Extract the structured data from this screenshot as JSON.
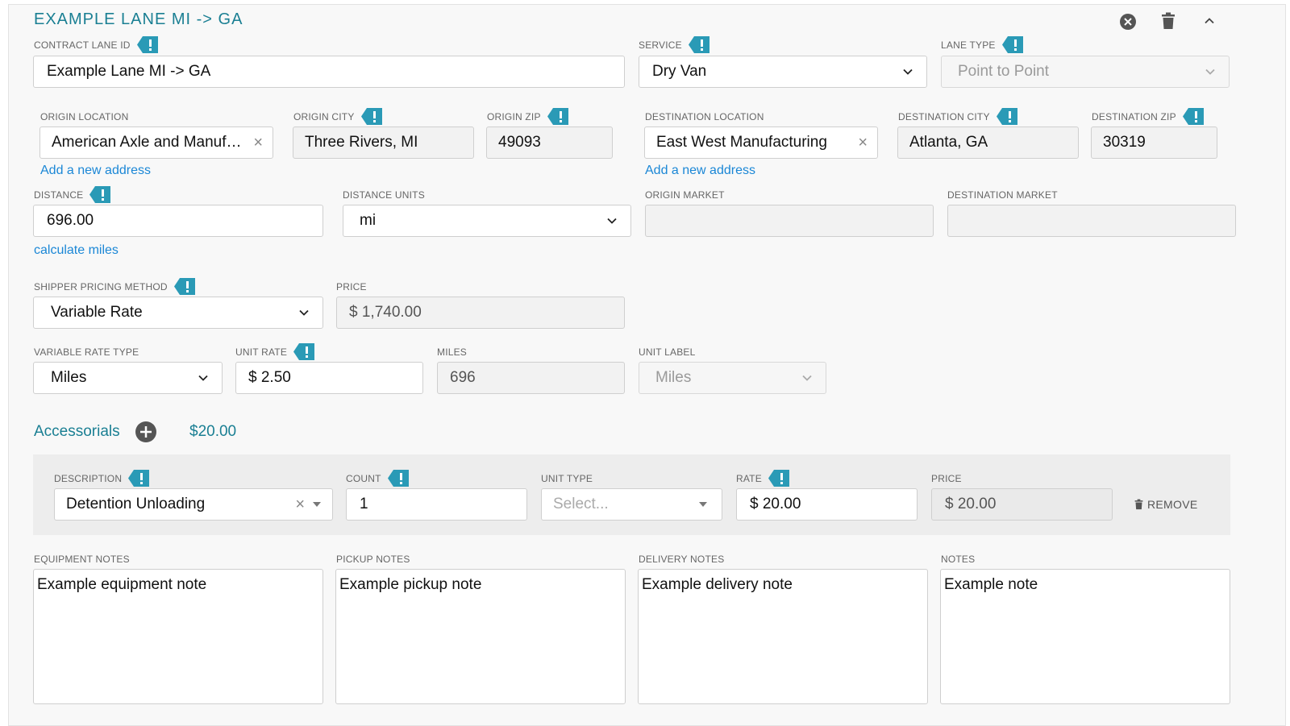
{
  "header": {
    "title": "EXAMPLE LANE MI -> GA"
  },
  "lane": {
    "contract_lane_id": {
      "label": "CONTRACT LANE ID",
      "value": "Example Lane MI -> GA"
    },
    "service": {
      "label": "SERVICE",
      "value": "Dry Van"
    },
    "lane_type": {
      "label": "LANE TYPE",
      "value": "Point to Point"
    }
  },
  "origin": {
    "location_label": "ORIGIN LOCATION",
    "location_value": "American Axle and Manufacturing",
    "city_label": "ORIGIN CITY",
    "city_value": "Three Rivers, MI",
    "zip_label": "ORIGIN ZIP",
    "zip_value": "49093",
    "add_address": "Add a new address"
  },
  "destination": {
    "location_label": "DESTINATION LOCATION",
    "location_value": "East West Manufacturing",
    "city_label": "DESTINATION CITY",
    "city_value": "Atlanta, GA",
    "zip_label": "DESTINATION ZIP",
    "zip_value": "30319",
    "add_address": "Add a new address"
  },
  "distance": {
    "label": "DISTANCE",
    "value": "696.00",
    "units_label": "DISTANCE UNITS",
    "units_value": "mi",
    "calculate_link": "calculate miles",
    "origin_market_label": "ORIGIN MARKET",
    "origin_market_value": "",
    "destination_market_label": "DESTINATION MARKET",
    "destination_market_value": ""
  },
  "pricing": {
    "method_label": "SHIPPER PRICING METHOD",
    "method_value": "Variable Rate",
    "price_label": "PRICE",
    "price_value": "$ 1,740.00",
    "rate_type_label": "VARIABLE RATE TYPE",
    "rate_type_value": "Miles",
    "unit_rate_label": "UNIT RATE",
    "unit_rate_value": "$ 2.50",
    "miles_label": "MILES",
    "miles_value": "696",
    "unit_label_label": "UNIT LABEL",
    "unit_label_value": "Miles"
  },
  "accessorials": {
    "title": "Accessorials",
    "total": "$20.00",
    "items": [
      {
        "description_label": "DESCRIPTION",
        "description_value": "Detention Unloading",
        "count_label": "COUNT",
        "count_value": "1",
        "unit_type_label": "UNIT TYPE",
        "unit_type_placeholder": "Select...",
        "rate_label": "RATE",
        "rate_value": "$ 20.00",
        "price_label": "PRICE",
        "price_value": "$ 20.00",
        "remove_label": "REMOVE"
      }
    ]
  },
  "notes": {
    "equipment_label": "EQUIPMENT NOTES",
    "equipment_value": "Example equipment note",
    "pickup_label": "PICKUP NOTES",
    "pickup_value": "Example pickup note",
    "delivery_label": "DELIVERY NOTES",
    "delivery_value": "Example delivery note",
    "notes_label": "NOTES",
    "notes_value": "Example note"
  },
  "colors": {
    "accent": "#1a7f93",
    "flag": "#2a9ab6",
    "link": "#1b87d6"
  }
}
